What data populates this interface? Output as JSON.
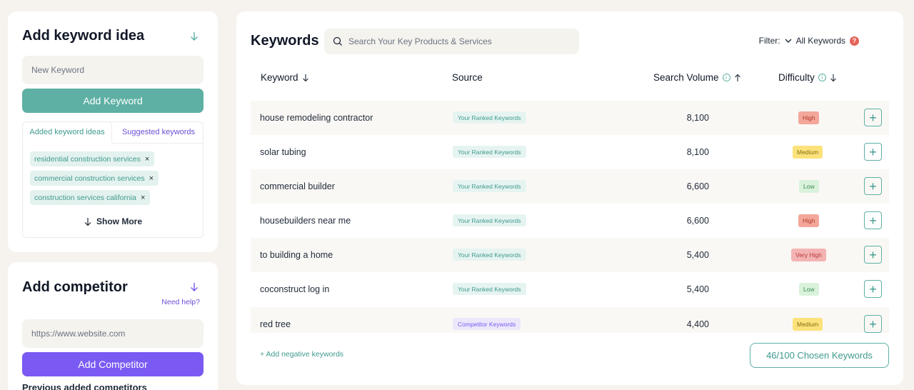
{
  "keyword_idea": {
    "title": "Add keyword idea",
    "input_placeholder": "New Keyword",
    "add_button": "Add Keyword",
    "tabs": [
      {
        "label": "Added keyword ideas",
        "active": true
      },
      {
        "label": "Suggested keywords",
        "active": false
      }
    ],
    "chips": [
      "residential construction services",
      "commercial construction services",
      "construction services california"
    ],
    "chip_remove": "×",
    "show_more": "Show More"
  },
  "competitor": {
    "title": "Add competitor",
    "help_link": "Need help?",
    "input_placeholder": "https://www.website.com",
    "add_button": "Add Competitor",
    "cut_text": "Previous added competitors"
  },
  "keywords": {
    "title": "Keywords",
    "search_placeholder": "Search Your Key Products & Services",
    "filter_label": "Filter:",
    "filter_value": "All Keywords",
    "filter_help": "?",
    "columns": {
      "keyword": "Keyword",
      "source": "Source",
      "volume": "Search Volume",
      "difficulty": "Difficulty"
    },
    "rows": [
      {
        "keyword": "house remodeling contractor",
        "source": "Your Ranked Keywords",
        "source_type": "ranked",
        "volume": "8,100",
        "difficulty": "High",
        "diff_type": "high"
      },
      {
        "keyword": "solar tubing",
        "source": "Your Ranked Keywords",
        "source_type": "ranked",
        "volume": "8,100",
        "difficulty": "Medium",
        "diff_type": "medium"
      },
      {
        "keyword": "commercial builder",
        "source": "Your Ranked Keywords",
        "source_type": "ranked",
        "volume": "6,600",
        "difficulty": "Low",
        "diff_type": "low"
      },
      {
        "keyword": "housebuilders near me",
        "source": "Your Ranked Keywords",
        "source_type": "ranked",
        "volume": "6,600",
        "difficulty": "High",
        "diff_type": "high"
      },
      {
        "keyword": "to building a home",
        "source": "Your Ranked Keywords",
        "source_type": "ranked",
        "volume": "5,400",
        "difficulty": "Very High",
        "diff_type": "veryhigh"
      },
      {
        "keyword": "coconstruct log in",
        "source": "Your Ranked Keywords",
        "source_type": "ranked",
        "volume": "5,400",
        "difficulty": "Low",
        "diff_type": "low"
      },
      {
        "keyword": "red tree",
        "source": "Competitor Keywords",
        "source_type": "competitor",
        "volume": "4,400",
        "difficulty": "Medium",
        "diff_type": "medium"
      }
    ],
    "add_negative": "+ Add negative keywords",
    "chosen_button": "46/100 Chosen Keywords"
  },
  "colors": {
    "teal": "#5eb0a4",
    "purple": "#7a5af3",
    "background": "#f6f3ee"
  }
}
